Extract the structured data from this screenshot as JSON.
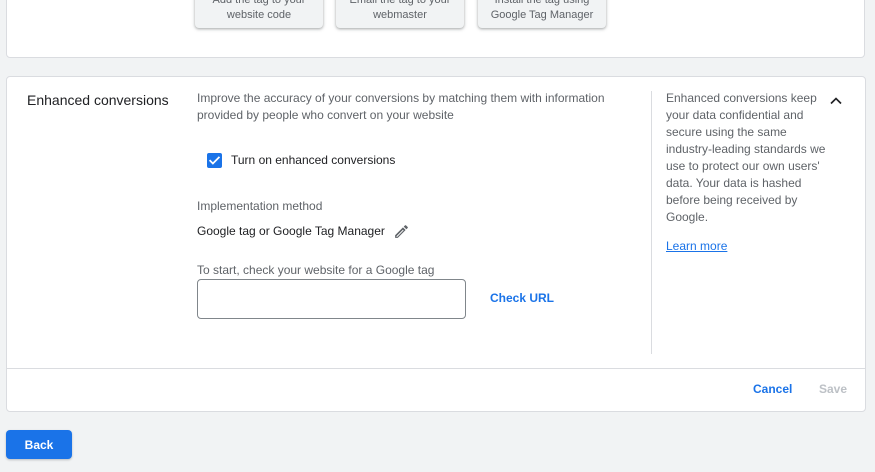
{
  "install_options": [
    {
      "line1": "Add the tag to your",
      "line2": "website code"
    },
    {
      "line1": "Email the tag to your",
      "line2": "webmaster"
    },
    {
      "line1": "Install the tag using",
      "line2": "Google Tag Manager"
    }
  ],
  "enhanced": {
    "title": "Enhanced conversions",
    "description": "Improve the accuracy of your conversions by matching them with information provided by people who convert on your website",
    "checkbox_label": "Turn on enhanced conversions",
    "checkbox_checked": true,
    "impl_label": "Implementation method",
    "impl_value": "Google tag or Google Tag Manager",
    "url_label": "To start, check your website for a Google tag",
    "url_value": "",
    "check_url_label": "Check URL",
    "side_text": "Enhanced conversions keep your data confidential and secure using the same industry-leading standards we use to protect our own users' data. Your data is hashed before being received by Google.",
    "learn_more": "Learn more",
    "cancel_label": "Cancel",
    "save_label": "Save"
  },
  "footer": {
    "back_label": "Back"
  },
  "icons": {
    "edit": "pencil-icon",
    "collapse": "chevron-up-icon",
    "check": "checkmark-icon"
  },
  "colors": {
    "accent": "#1a73e8",
    "text": "#202124",
    "muted": "#5f6368",
    "disabled": "#bdc1c6",
    "background": "#f1f3f4"
  }
}
